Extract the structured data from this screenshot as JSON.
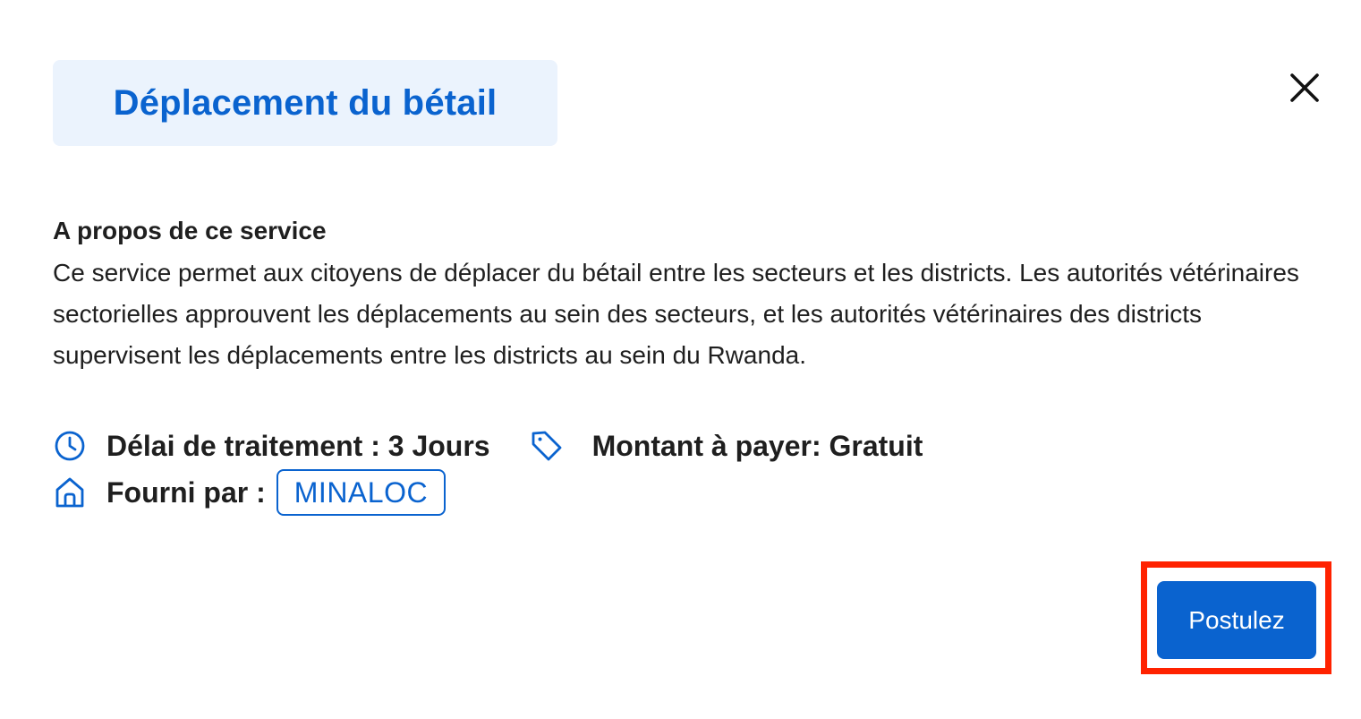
{
  "modal": {
    "title": "Déplacement du bétail",
    "close_icon": "close-icon"
  },
  "about": {
    "heading": "A propos de ce service",
    "description": "Ce service permet aux citoyens de déplacer du bétail entre les secteurs et les districts. Les autorités vétérinaires sectorielles approuvent les déplacements au sein des secteurs, et les autorités vétérinaires des districts supervisent les déplacements entre les districts au sein du Rwanda."
  },
  "meta": {
    "processing_time": "Délai de traitement : 3 Jours",
    "amount": "Montant à payer: Gratuit",
    "provider_label": "Fourni par :",
    "provider": "MINALOC"
  },
  "actions": {
    "apply_label": "Postulez"
  },
  "colors": {
    "accent": "#0a63cf",
    "title_bg": "#ebf3fd",
    "highlight": "#ff2200"
  }
}
